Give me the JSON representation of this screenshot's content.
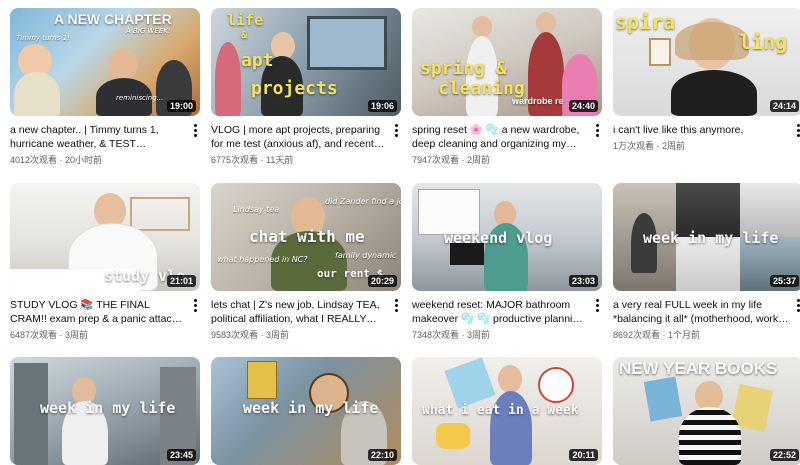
{
  "colors": {
    "title_text": "#0f0f0f",
    "meta_text": "#606060",
    "duration_bg": "#000000cc",
    "accent_yellow": "#f5e25b"
  },
  "videos": [
    {
      "title": "a new chapter.. | Timmy turns 1, hurricane weather, & TEST RESULTS! 🙈",
      "views": "4012次观看",
      "age": "20小时前",
      "duration": "19:00",
      "overlay": "A NEW CHAPTER",
      "overlay2": "A BIG WEEK!",
      "overlay3": "Timmy turns 1!",
      "overlay4": "reminiscing..."
    },
    {
      "title": "VLOG | more apt projects, preparing for me test (anxious af), and recent book reviews!",
      "views": "6775次观看",
      "age": "11天前",
      "duration": "19:06",
      "overlay": "life",
      "overlay2": "&",
      "overlay3": "apt",
      "overlay4": "projects"
    },
    {
      "title": "spring reset 🌸 🫧 a new wardrobe, deep cleaning and organizing my apartment!",
      "views": "7947次观看",
      "age": "2周前",
      "duration": "24:40",
      "overlay": "spring &",
      "overlay2": "cleaning",
      "overlay3": "wardrobe re"
    },
    {
      "title": "i can't live like this anymore.",
      "views": "1万次观看",
      "age": "2周前",
      "duration": "24:14",
      "overlay": "spira",
      "overlay2": "ling"
    },
    {
      "title": "STUDY VLOG 📚 THE FINAL CRAM!! exam prep & a panic attack (yay!)",
      "views": "6487次观看",
      "age": "3周前",
      "duration": "21:01",
      "overlay": "study vlo"
    },
    {
      "title": "lets chat | Z's new job, Lindsay TEA, political affiliation, what I REALLY experienced in N...",
      "views": "9583次观看",
      "age": "3周前",
      "duration": "20:29",
      "overlay": "chat with me",
      "overlay2": "Lindsay tea",
      "overlay3": "did Zander find a job?!",
      "overlay4": "what happened in NC?",
      "overlay5": "family dynamic",
      "overlay6": "our rent $"
    },
    {
      "title": "weekend reset: MAJOR bathroom makeover 🫧 🫧 productive planning + cozy candle...",
      "views": "7348次观看",
      "age": "3周前",
      "duration": "23:03",
      "overlay": "weekend vlog"
    },
    {
      "title": "a very real FULL week in my life *balancing it all* (motherhood, work, studying, health)",
      "views": "8692次观看",
      "age": "1个月前",
      "duration": "25:37",
      "overlay": "week in my life"
    },
    {
      "title": "",
      "views": "",
      "age": "",
      "duration": "23:45",
      "overlay": "week in my life"
    },
    {
      "title": "",
      "views": "",
      "age": "",
      "duration": "22:10",
      "overlay": "week in my life"
    },
    {
      "title": "",
      "views": "",
      "age": "",
      "duration": "20:11",
      "overlay": "what i eat in a week"
    },
    {
      "title": "",
      "views": "",
      "age": "",
      "duration": "22:52",
      "overlay": "NEW YEAR BOOKS"
    }
  ],
  "meta_separator": " · "
}
